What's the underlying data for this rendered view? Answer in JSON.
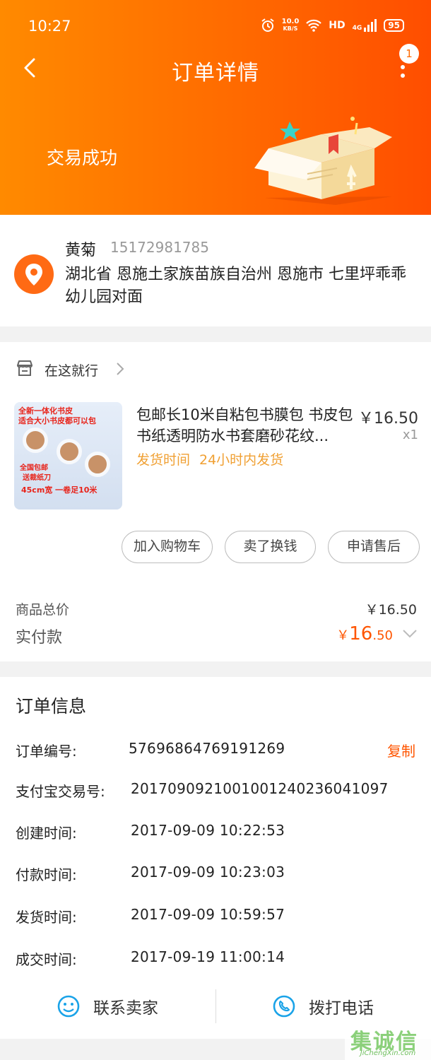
{
  "status_bar": {
    "time": "10:27",
    "speed_value": "10.0",
    "speed_unit": "KB/S",
    "network": "HD",
    "signal": "4G",
    "battery": "95"
  },
  "header": {
    "title": "订单详情",
    "badge_count": "1",
    "trade_status": "交易成功"
  },
  "address": {
    "name": "黄菊",
    "phone": "15172981785",
    "detail": "湖北省 恩施土家族苗族自治州 恩施市 七里坪乖乖幼儿园对面"
  },
  "shop": {
    "name": "在这就行"
  },
  "product": {
    "title": "包邮长10米自粘包书膜包 书皮包书纸透明防水书套磨砂花纹...",
    "price": "￥16.50",
    "quantity": "x1",
    "ship_label": "发货时间",
    "ship_value": "24小时内发货",
    "thumb": {
      "line1": "全新一体化书皮",
      "line2": "适合大小书皮都可以包",
      "line3": "全国包邮",
      "line4": "送裁纸刀",
      "line5": "45cm宽   一卷足10米"
    }
  },
  "actions": {
    "add_cart": "加入购物车",
    "resell": "卖了换钱",
    "after_sale": "申请售后"
  },
  "totals": {
    "goods_label": "商品总价",
    "goods_value": "￥16.50",
    "paid_label": "实付款",
    "paid_yen": "￥",
    "paid_int": "16",
    "paid_dec": ".50"
  },
  "order_info": {
    "title": "订单信息",
    "copy": "复制",
    "rows": [
      {
        "label": "订单编号:",
        "value": "57696864769191269"
      },
      {
        "label": "支付宝交易号:",
        "value": "2017090921001001240236041097"
      },
      {
        "label": "创建时间:",
        "value": "2017-09-09 10:22:53"
      },
      {
        "label": "付款时间:",
        "value": "2017-09-09 10:23:03"
      },
      {
        "label": "发货时间:",
        "value": "2017-09-09 10:59:57"
      },
      {
        "label": "成交时间:",
        "value": "2017-09-19 11:00:14"
      }
    ]
  },
  "footer": {
    "contact_seller": "联系卖家",
    "call_phone": "拨打电话"
  },
  "watermark": {
    "main": "集诚信",
    "sub": "JiChengXin.com"
  },
  "colors": {
    "accent": "#ff6a00",
    "price_orange": "#ff5500",
    "ship_orange": "#f0a033",
    "icon_blue": "#1aa3e8"
  }
}
